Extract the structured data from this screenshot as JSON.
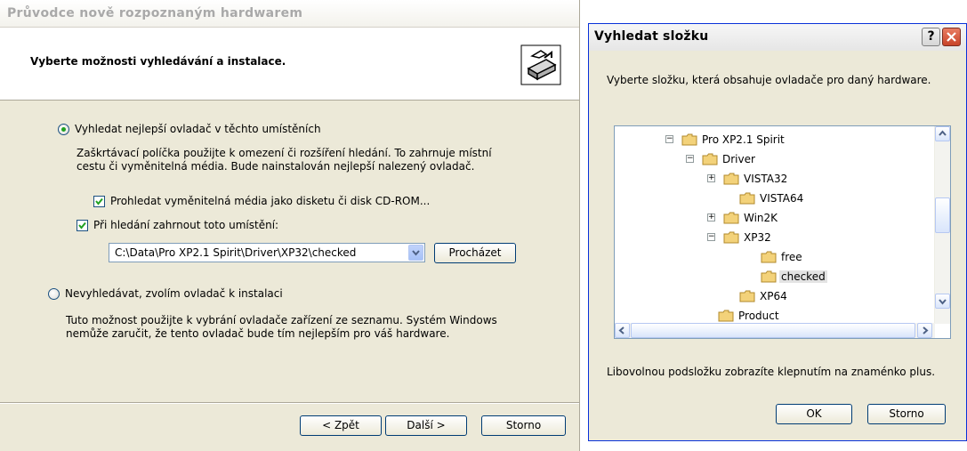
{
  "wizard": {
    "title": "Průvodce nově rozpoznaným hardwarem",
    "heading": "Vyberte možnosti vyhledávání a instalace.",
    "option_search": {
      "label": "Vyhledat nejlepší ovladač v těchto umístěních",
      "selected": true,
      "description_line1": "Zaškrtávací políčka použijte k omezení či rozšíření hledání. To zahrnuje místní",
      "description_line2": "cestu či vyměnitelná média. Bude nainstalován nejlepší nalezený ovladač.",
      "checkbox_media": {
        "label": "Prohledat vyměnitelná média jako disketu či disk CD-ROM...",
        "checked": true
      },
      "checkbox_location": {
        "label": "Při hledání zahrnout toto umístění:",
        "checked": true
      },
      "location_value": "C:\\Data\\Pro XP2.1 Spirit\\Driver\\XP32\\checked",
      "browse_label": "Procházet"
    },
    "option_manual": {
      "label": "Nevyhledávat, zvolím ovladač k instalaci",
      "selected": false,
      "description_line1": "Tuto možnost použijte k vybrání ovladače zařízení ze seznamu. Systém Windows",
      "description_line2": "nemůže zaručit, že tento ovladač bude tím nejlepším pro váš hardware."
    },
    "buttons": {
      "back": "< Zpět",
      "next": "Další >",
      "cancel": "Storno"
    }
  },
  "folder_dialog": {
    "title": "Vyhledat složku",
    "help_label": "?",
    "description": "Vyberte složku, která obsahuje ovladače pro daný hardware.",
    "tree": [
      {
        "label": "Pro XP2.1 Spirit",
        "expander": "minus"
      },
      {
        "label": "Driver",
        "expander": "minus"
      },
      {
        "label": "VISTA32",
        "expander": "plus"
      },
      {
        "label": "VISTA64",
        "expander": ""
      },
      {
        "label": "Win2K",
        "expander": "plus"
      },
      {
        "label": "XP32",
        "expander": "minus"
      },
      {
        "label": "free",
        "expander": ""
      },
      {
        "label": "checked",
        "expander": "",
        "selected": true
      },
      {
        "label": "XP64",
        "expander": ""
      },
      {
        "label": "Product",
        "expander": ""
      }
    ],
    "hint": "Libovolnou podsložku zobrazíte klepnutím na znaménko plus.",
    "buttons": {
      "ok": "OK",
      "cancel": "Storno"
    }
  },
  "colors": {
    "accent_selected": "#21a121",
    "title_bar_dialog": "#0831d9",
    "folder": "#f3d27a"
  }
}
